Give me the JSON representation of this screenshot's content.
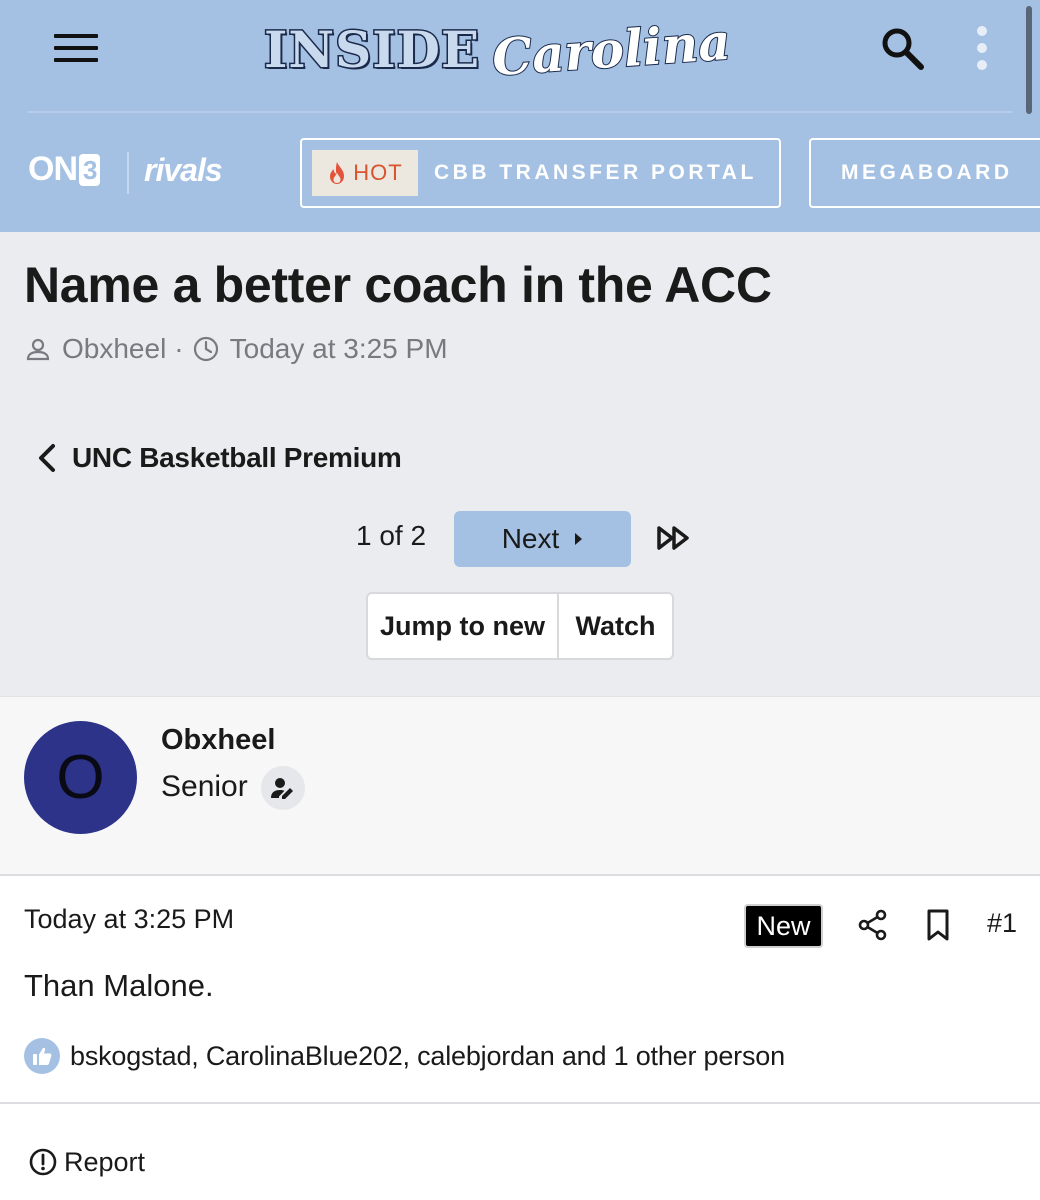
{
  "header": {
    "logo_word1": "INSIDE",
    "logo_word2": "Carolina",
    "on3_label": "ON",
    "on3_digit": "3",
    "rivals_label": "rivals",
    "hot_badge": "HOT",
    "portal_label": "CBB TRANSFER PORTAL",
    "megaboard_label": "MEGABOARD"
  },
  "thread": {
    "title": "Name a better coach in the ACC",
    "author": "Obxheel",
    "separator": "·",
    "posted": "Today at 3:25 PM",
    "forum": "UNC Basketball Premium"
  },
  "pagination": {
    "page_of": "1 of 2",
    "next_label": "Next"
  },
  "actions": {
    "jump_label": "Jump to new",
    "watch_label": "Watch"
  },
  "post": {
    "avatar_letter": "O",
    "author": "Obxheel",
    "role": "Senior",
    "time": "Today at 3:25 PM",
    "new_badge": "New",
    "number": "#1",
    "body": "Than Malone.",
    "reactions": "bskogstad, CarolinaBlue202, calebjordan and 1 other person",
    "report_label": "Report"
  },
  "colors": {
    "header_bg": "#a4c1e4",
    "avatar_bg": "#2c3389",
    "hot_text": "#d9542c"
  }
}
